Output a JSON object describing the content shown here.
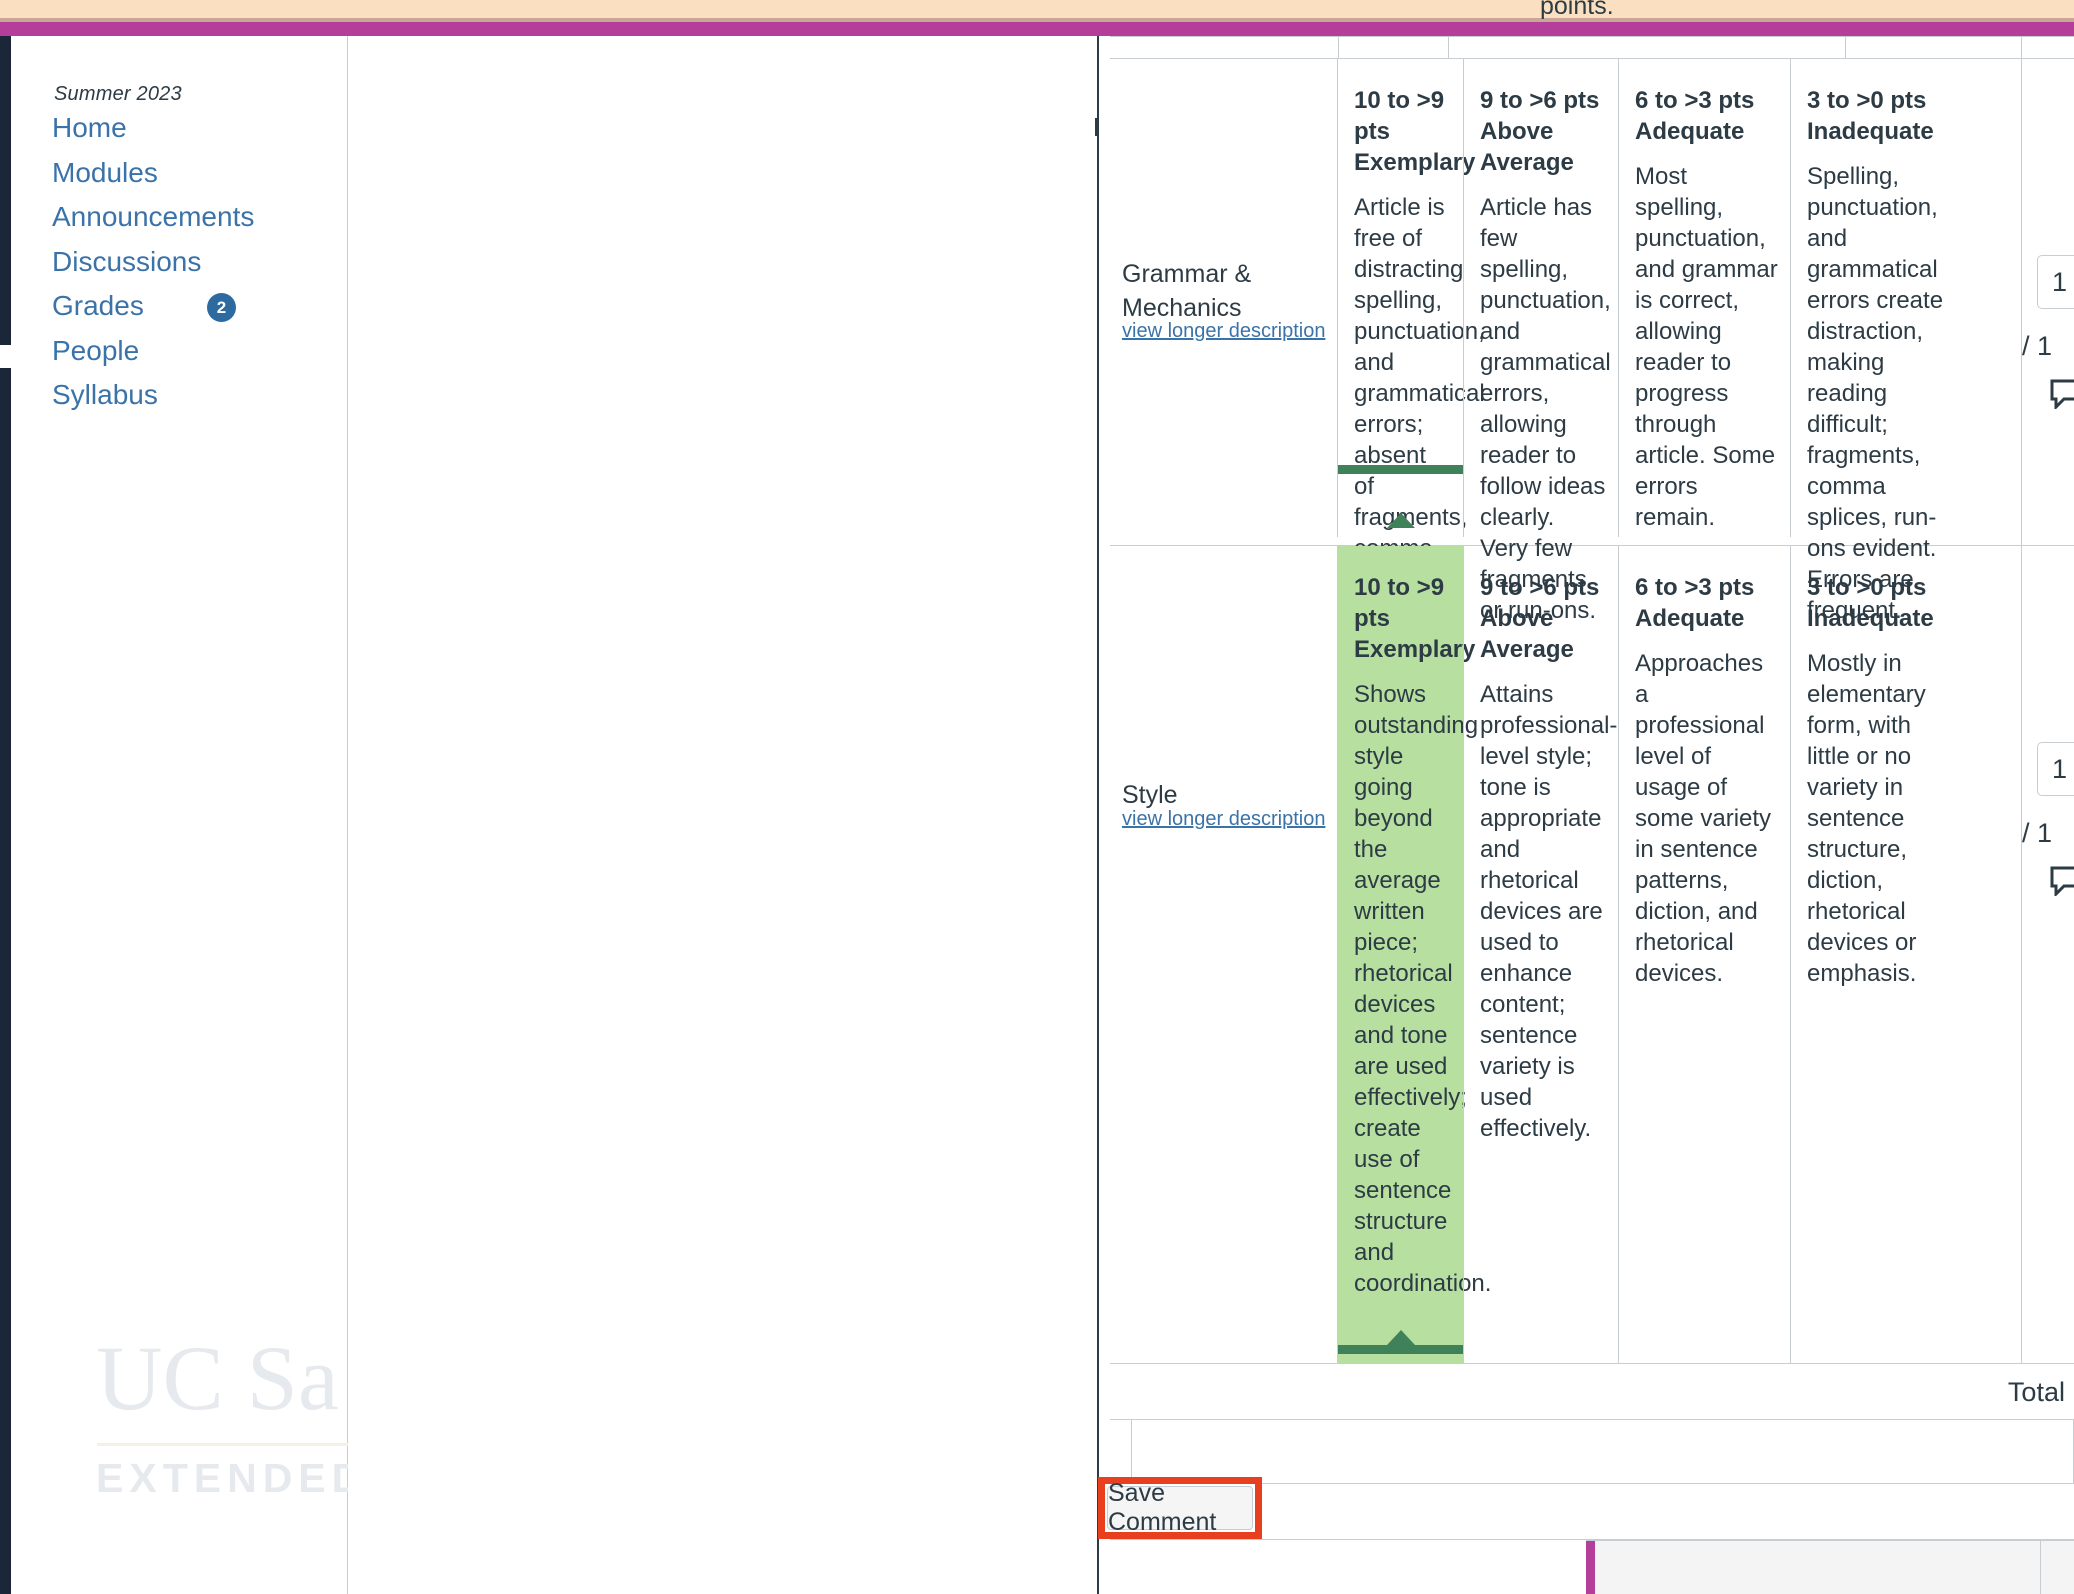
{
  "chrome": {
    "peach_color": "#fae0c0",
    "magenta_color": "#b43f9b",
    "navy_color": "#1b2738"
  },
  "sidebar": {
    "term": "Summer 2023",
    "items": [
      {
        "label": "Home",
        "badge": null
      },
      {
        "label": "Modules",
        "badge": null
      },
      {
        "label": "Announcements",
        "badge": null
      },
      {
        "label": "Discussions",
        "badge": null
      },
      {
        "label": "Grades",
        "badge": "2"
      },
      {
        "label": "People",
        "badge": null
      },
      {
        "label": "Syllabus",
        "badge": null
      }
    ],
    "link_color": "#3b73a8",
    "badge_color": "#2d6a9f"
  },
  "watermark": {
    "line1": "UC Sa",
    "line2": "EXTENDED"
  },
  "rubric": {
    "clipped_top_text": "points.",
    "view_longer_description_label": "view longer description",
    "selected_color": "#b7dfa0",
    "selected_bar_color": "#3f8259",
    "criteria": [
      {
        "name": "Grammar & Mechanics",
        "has_longer_description": true,
        "selected_index": 0,
        "selected_highlight": false,
        "points_value": "1",
        "points_out_of": "/ 1",
        "ratings": [
          {
            "points": "10 to >9 pts",
            "level": "Exemplary",
            "description": "Article is free of distracting spelling, punctuation, and grammatical errors; absent of fragments, comma splices, and run-ons."
          },
          {
            "points": "9 to >6 pts",
            "level": "Above Average",
            "description": "Article has few spelling, punctuation, and grammatical errors, allowing reader to follow ideas clearly. Very few fragments or run-ons."
          },
          {
            "points": "6 to >3 pts",
            "level": "Adequate",
            "description": "Most spelling, punctuation, and grammar is correct, allowing reader to progress through article. Some errors remain."
          },
          {
            "points": "3 to >0 pts",
            "level": "Inadequate",
            "description": "Spelling, punctuation, and grammatical errors create distraction, making reading difficult; fragments, comma splices, run-ons evident. Errors are frequent."
          }
        ]
      },
      {
        "name": "Style",
        "has_longer_description": true,
        "selected_index": 0,
        "selected_highlight": true,
        "points_value": "1",
        "points_out_of": "/ 1",
        "ratings": [
          {
            "points": "10 to >9 pts",
            "level": "Exemplary",
            "description": "Shows outstanding style going beyond the average written piece; rhetorical devices and tone are used effectively; create use of sentence structure and coordination."
          },
          {
            "points": "9 to >6 pts",
            "level": "Above Average",
            "description": "Attains professional-level style; tone is appropriate and rhetorical devices are used to enhance content; sentence variety is used effectively."
          },
          {
            "points": "6 to >3 pts",
            "level": "Adequate",
            "description": "Approaches a professional level of usage of some variety in sentence patterns, diction, and rhetorical devices."
          },
          {
            "points": "3 to >0 pts",
            "level": "Inadequate",
            "description": "Mostly in elementary form, with little or no variety in sentence structure, diction, rhetorical devices or emphasis."
          }
        ]
      }
    ],
    "total_points_label": "Total Point"
  },
  "actions": {
    "save_comment_label": "Save Comment",
    "highlight_color": "#e8401f"
  }
}
